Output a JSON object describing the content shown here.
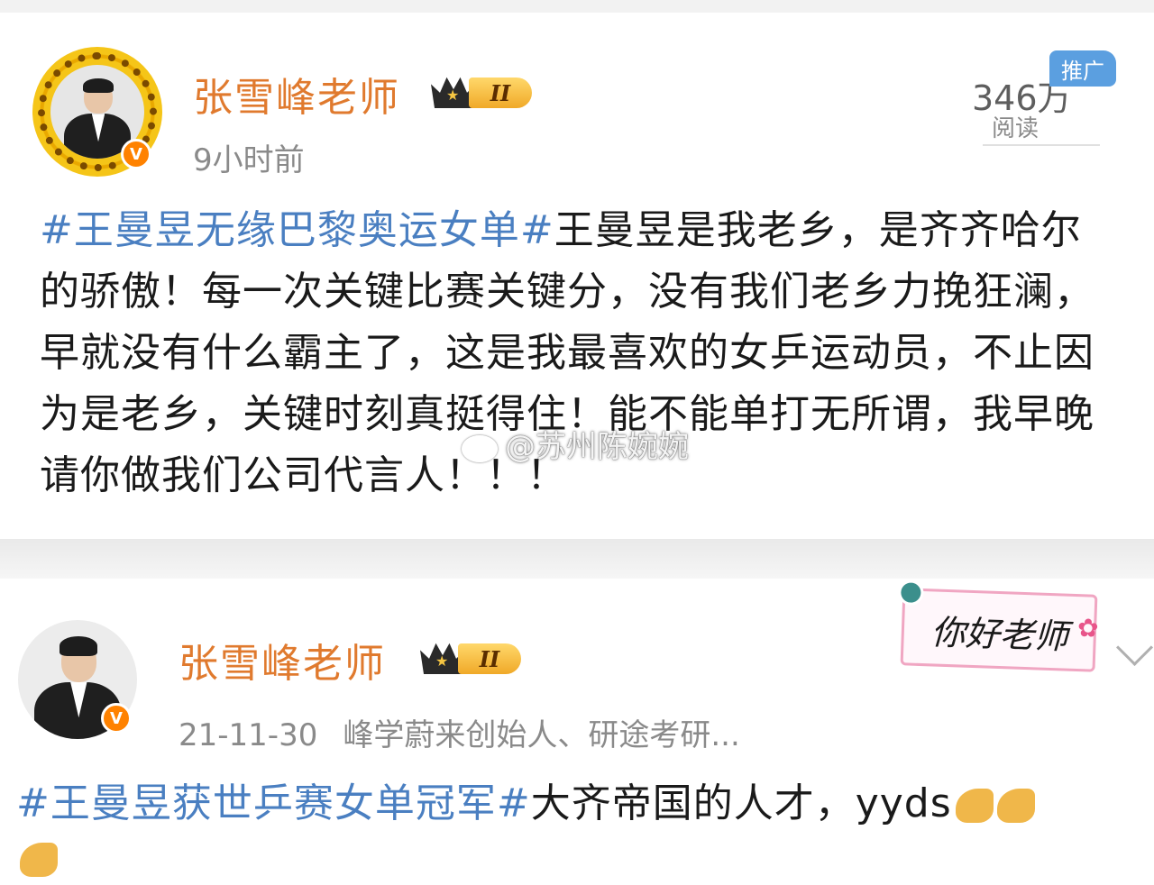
{
  "post1": {
    "username": "张雪峰老师",
    "level_badge": "II",
    "timestamp": "9小时前",
    "reads_count": "346万",
    "reads_label": "阅读",
    "promo_tag": "推广",
    "hashtag": "#王曼昱无缘巴黎奥运女单#",
    "text": "王曼昱是我老乡，是齐齐哈尔的骄傲！每一次关键比赛关键分，没有我们老乡力挽狂澜，早就没有什么霸主了，这是我最喜欢的女乒运动员，不止因为是老乡，关键时刻真挺得住！能不能单打无所谓，我早晚请你做我们公司代言人！！！",
    "verified_mark": "V"
  },
  "watermark": {
    "text": "@苏州陈婉婉"
  },
  "post2": {
    "username": "张雪峰老师",
    "level_badge": "II",
    "date": "21-11-30",
    "bio": "峰学蔚来创始人、研途考研...",
    "sticker_text": "你好老师",
    "hashtag": "#王曼昱获世乒赛女单冠军#",
    "text": "大齐帝国的人才，yyds",
    "verified_mark": "V"
  },
  "icons": [
    "crown-icon",
    "verified-icon",
    "weibo-icon",
    "arm-emoji-icon",
    "chevron-down-icon"
  ],
  "colors": {
    "username": "#e07a2e",
    "hashtag": "#4a7fc1",
    "verified": "#ff8200",
    "promo": "#5b9fe0"
  }
}
